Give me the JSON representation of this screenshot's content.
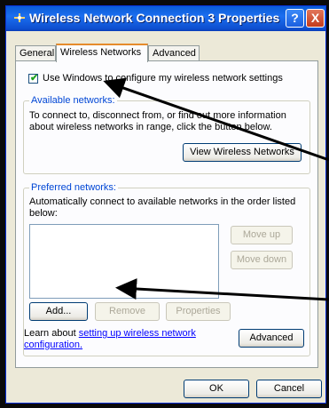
{
  "window": {
    "title": "Wireless Network Connection 3 Properties",
    "help_label": "?",
    "close_label": "X"
  },
  "tabs": [
    {
      "label": "General",
      "active": false
    },
    {
      "label": "Wireless Networks",
      "active": true
    },
    {
      "label": "Advanced",
      "active": false
    }
  ],
  "use_windows": {
    "label": "Use Windows to configure my wireless network settings",
    "checked": true
  },
  "available": {
    "title": "Available networks:",
    "line1": "To connect to, disconnect from, or find out more information",
    "line2": "about wireless networks in range, click the button below.",
    "view_button": "View Wireless Networks"
  },
  "preferred": {
    "title": "Preferred networks:",
    "line1": "Automatically connect to available networks in the order listed",
    "line2": "below:",
    "move_up": "Move up",
    "move_down": "Move down",
    "add": "Add...",
    "remove": "Remove",
    "properties": "Properties"
  },
  "learn": {
    "prefix": "Learn about ",
    "link1": "setting up wireless network",
    "link2": "configuration.",
    "advanced_button": "Advanced"
  },
  "footer": {
    "ok": "OK",
    "cancel": "Cancel"
  },
  "colors": {
    "titlebar": "#0a5bd6",
    "group_title": "#0046d5",
    "link": "#0000ff",
    "arrow": "#000000"
  }
}
